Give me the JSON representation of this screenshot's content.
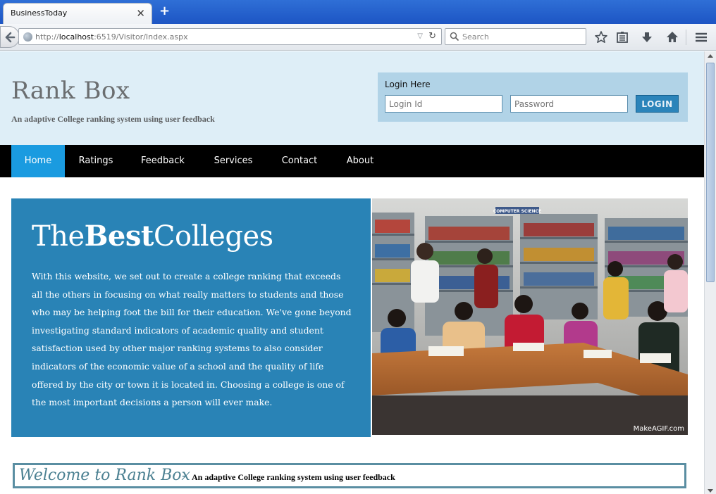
{
  "browser": {
    "tab_title": "BusinessToday",
    "tab_close": "✕",
    "new_tab": "+",
    "url_prefix": "http://",
    "url_host": "localhost",
    "url_rest": ":6519/Visitor/Index.aspx",
    "search_placeholder": "Search"
  },
  "header": {
    "title": "Rank Box",
    "tagline": "An adaptive College ranking system using user feedback"
  },
  "login": {
    "heading": "Login Here",
    "login_id_placeholder": "Login Id",
    "password_placeholder": "Password",
    "button_label": "LOGIN"
  },
  "menu": {
    "items": [
      {
        "label": "Home"
      },
      {
        "label": "Ratings"
      },
      {
        "label": "Feedback"
      },
      {
        "label": "Services"
      },
      {
        "label": "Contact"
      },
      {
        "label": "About"
      }
    ]
  },
  "hero": {
    "title_pre": "The",
    "title_bold": "Best",
    "title_post": "Colleges",
    "text": "With this website, we set out to create a college ranking that exceeds all the others in focusing on what really matters to students and those who may be helping foot the bill for their education. We've gone beyond investigating standard indicators of academic quality and student satisfaction used by other major ranking systems to also consider indicators of the economic value of a school and the quality of life offered by the city or town it is located in. Choosing a college is one of the most important decisions a person will ever make.",
    "photo_sign": "COMPUTER SCIENCE",
    "watermark": "MakeAGIF.com"
  },
  "welcome": {
    "title": "Welcome to Rank Box",
    "dash": "-",
    "subtitle": "An adaptive College ranking system using user feedback"
  },
  "colors": {
    "header_bg": "#deeef7",
    "login_bg": "#b1d3e7",
    "menu_bg": "#000000",
    "menu_active": "#1a9be0",
    "hero_bg": "#2983b6",
    "welcome_border": "#5a8ea2"
  }
}
